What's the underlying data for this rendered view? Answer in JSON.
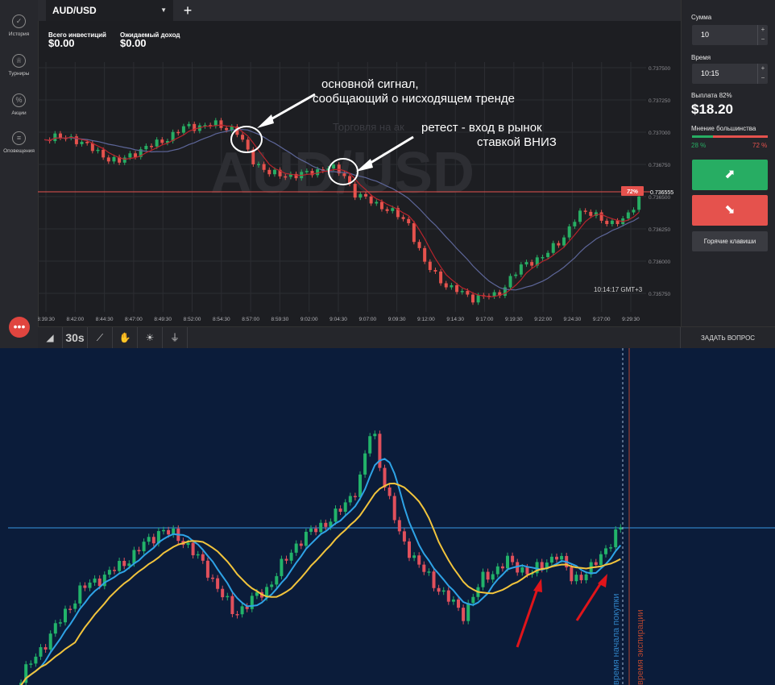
{
  "nav": {
    "history": "История",
    "tournaments": "Турниры",
    "promotions": "Акции",
    "alerts": "Оповещения"
  },
  "tab": {
    "asset": "AUD/USD"
  },
  "stats": {
    "invest_label": "Всего инвестиций",
    "invest_value": "$0.00",
    "income_label": "Ожидаемый доход",
    "income_value": "$0.00"
  },
  "chart": {
    "watermark": "AUD/USD",
    "sub_watermark": "Торговля на ак",
    "price_labels": [
      "0.737500",
      "0.737250",
      "0.737000",
      "0.736750",
      "0.736500",
      "0.736250",
      "0.736000",
      "0.735750"
    ],
    "time_labels": [
      "8:39:30",
      "8:42:00",
      "8:44:30",
      "8:47:00",
      "8:49:30",
      "8:52:00",
      "8:54:30",
      "8:57:00",
      "8:59:30",
      "9:02:00",
      "9:04:30",
      "9:07:00",
      "9:09:30",
      "9:12:00",
      "9:14:30",
      "9:17:00",
      "9:19:30",
      "9:22:00",
      "9:24:30",
      "9:27:00",
      "9:29:30"
    ],
    "current_price": "0.736555",
    "current_payout": "72%",
    "clock": "10:14:17 GMT+3",
    "annotation1_line1": "основной сигнал,",
    "annotation1_line2": "сообщающий о нисходящем тренде",
    "annotation2_line1": "ретест - вход в рынок",
    "annotation2_line2": "ставкой ВНИЗ"
  },
  "toolbar": {
    "timeframe": "30s",
    "ask_question": "ЗАДАТЬ ВОПРОС"
  },
  "panel": {
    "amount_label": "Сумма",
    "amount_value": "10",
    "time_label": "Время",
    "time_value": "10:15",
    "payout_label": "Выплата 82%",
    "payout_value": "$18.20",
    "sentiment_label": "Мнение большинства",
    "sentiment_up": "28 %",
    "sentiment_down": "72 %",
    "hotkeys": "Горячие клавиши",
    "colors": {
      "up": "#27ad63",
      "down": "#e5524d"
    }
  },
  "bottom_chart": {
    "purchase_time_label": "время начала покупки",
    "expiration_label": "время экспирации"
  }
}
